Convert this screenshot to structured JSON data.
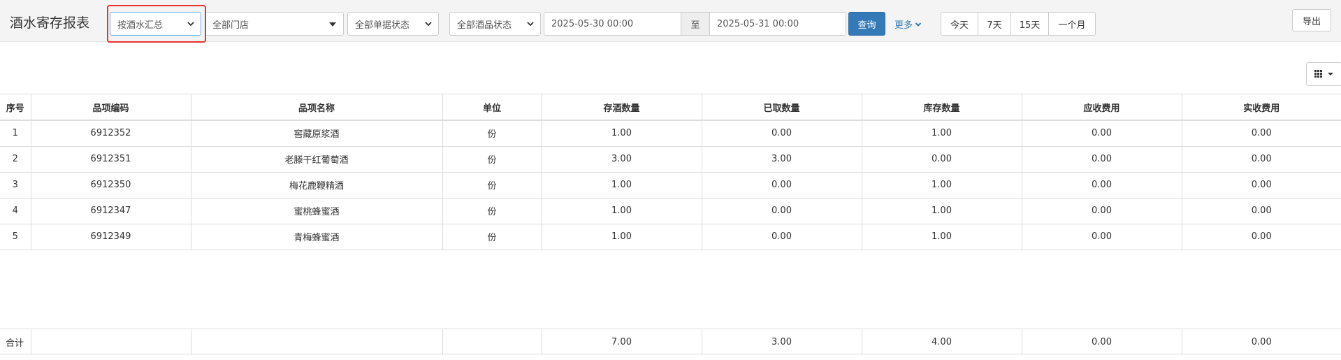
{
  "page": {
    "title": "酒水寄存报表"
  },
  "filters": {
    "summary_mode": "按酒水汇总",
    "store": "全部门店",
    "document_status": "全部单据状态",
    "wine_status": "全部酒品状态",
    "date_start": "2025-05-30 00:00",
    "date_separator": "至",
    "date_end": "2025-05-31 00:00",
    "query_label": "查询",
    "more_label": "更多"
  },
  "quick_ranges": [
    "今天",
    "7天",
    "15天",
    "一个月"
  ],
  "toolbar": {
    "export_label": "导出"
  },
  "table": {
    "columns": [
      "序号",
      "品项编码",
      "品项名称",
      "单位",
      "存酒数量",
      "已取数量",
      "库存数量",
      "应收费用",
      "实收费用"
    ],
    "rows": [
      [
        "1",
        "6912352",
        "窖藏原浆酒",
        "份",
        "1.00",
        "0.00",
        "1.00",
        "0.00",
        "0.00"
      ],
      [
        "2",
        "6912351",
        "老滕干红葡萄酒",
        "份",
        "3.00",
        "3.00",
        "0.00",
        "0.00",
        "0.00"
      ],
      [
        "3",
        "6912350",
        "梅花鹿鞭精酒",
        "份",
        "1.00",
        "0.00",
        "1.00",
        "0.00",
        "0.00"
      ],
      [
        "4",
        "6912347",
        "蜜桃蜂蜜酒",
        "份",
        "1.00",
        "0.00",
        "1.00",
        "0.00",
        "0.00"
      ],
      [
        "5",
        "6912349",
        "青梅蜂蜜酒",
        "份",
        "1.00",
        "0.00",
        "1.00",
        "0.00",
        "0.00"
      ]
    ],
    "totals": [
      "合计",
      "",
      "",
      "",
      "7.00",
      "3.00",
      "4.00",
      "0.00",
      "0.00"
    ]
  },
  "colors": {
    "primary": "#337ab7",
    "highlight": "#e8322e",
    "toolbar_bg": "#f4f4f4",
    "border": "#dddddd"
  }
}
